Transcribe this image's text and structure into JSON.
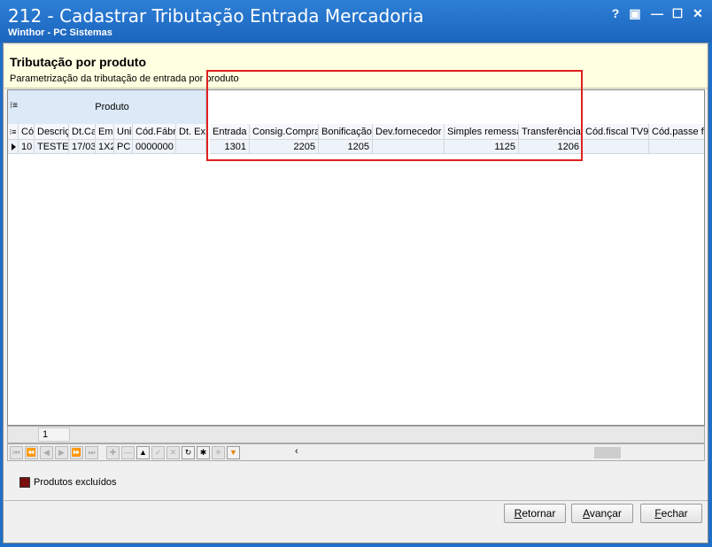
{
  "window": {
    "title": "212 - Cadastrar Tributação Entrada Mercadoria",
    "subtitle": "Winthor - PC Sistemas",
    "controls": [
      "?",
      "▣",
      "—",
      "☐",
      "✕"
    ]
  },
  "header": {
    "title": "Tributação por produto",
    "description": "Parametrização da tributação de entrada por produto"
  },
  "grid": {
    "band_label": "Produto",
    "columns": [
      "Cód",
      "Descriç",
      "Dt.Ca",
      "Eml",
      "Uni",
      "Cód.Fábr",
      "Dt. Ex",
      "Entrada",
      "Consig.Compra",
      "Bonificação",
      "Dev.fornecedor",
      "Simples remessa",
      "Transferência",
      "Cód.fiscal TV9",
      "Cód.passe fi"
    ],
    "row": [
      "10",
      "TESTES",
      "17/03",
      "1X2",
      "PC",
      "0000000",
      "",
      "1301",
      "2205",
      "1205",
      "",
      "1125",
      "1206",
      "",
      ""
    ]
  },
  "footer": {
    "page_value": "1"
  },
  "legend": {
    "label": "Produtos excluídos",
    "color": "#7a0f0f"
  },
  "buttons": {
    "retornar_first": "R",
    "retornar_rest": "etornar",
    "avancar_first": "A",
    "avancar_rest": "vançar",
    "fechar_first": "F",
    "fechar_rest": "echar"
  },
  "colors": {
    "titlebar": "#1f6fc8",
    "highlight": "#e02020"
  }
}
